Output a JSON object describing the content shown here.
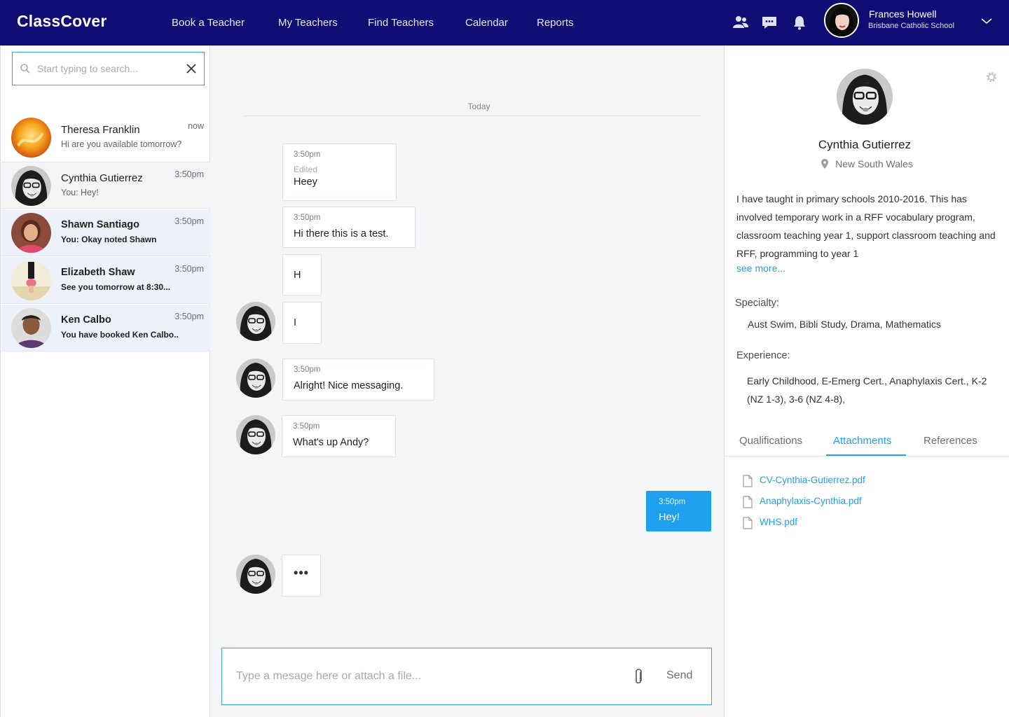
{
  "app": {
    "logo": "ClassCover"
  },
  "nav": [
    "Book a Teacher",
    "My Teachers",
    "Find Teachers",
    "Calendar",
    "Reports"
  ],
  "user": {
    "name": "Frances Howell",
    "school": "Brisbane Catholic School"
  },
  "search": {
    "placeholder": "Start typing to search..."
  },
  "conversations": [
    {
      "name": "Theresa Franklin",
      "preview": "Hi are you available tomorrow?",
      "time": "now"
    },
    {
      "name": "Cynthia Gutierrez",
      "preview": "You: Hey!",
      "time": "3:50pm"
    },
    {
      "name": "Shawn Santiago",
      "preview": "You: Okay noted Shawn",
      "time": "3:50pm"
    },
    {
      "name": "Elizabeth Shaw",
      "preview": "See you tomorrow at 8:30...",
      "time": "3:50pm"
    },
    {
      "name": "Ken Calbo",
      "preview": "You have booked Ken Calbo..",
      "time": "3:50pm"
    }
  ],
  "chat": {
    "day": "Today",
    "messages": [
      {
        "time": "3:50pm",
        "edited": "Edited",
        "text": "Heey"
      },
      {
        "time": "3:50pm",
        "text": "Hi there this is a test."
      },
      {
        "text": "H"
      },
      {
        "text": "I"
      },
      {
        "time": "3:50pm",
        "text": "Alright! Nice messaging."
      },
      {
        "time": "3:50pm",
        "text": "What's up Andy?"
      },
      {
        "time": "3:50pm",
        "text": "Hey!"
      },
      {
        "text": "•••"
      }
    ],
    "composer_placeholder": "Type a mesage here or attach a file...",
    "send": "Send"
  },
  "profile": {
    "name": "Cynthia Gutierrez",
    "location": "New South Wales",
    "bio": "I have taught in primary schools 2010-2016. This has involved temporary work in a RFF vocabulary program, classroom teaching year 1, support classroom teaching and RFF, programming to year 1",
    "see_more": "see more...",
    "specialty_label": "Specialty:",
    "specialty": "Aust Swim, Bibli Study, Drama, Mathematics",
    "experience_label": "Experience:",
    "experience": "Early Childhood, E-Emerg Cert., Anaphylaxis Cert., K-2 (NZ 1-3), 3-6 (NZ 4-8),",
    "tabs": [
      "Qualifications",
      "Attachments",
      "References"
    ],
    "active_tab": "Attachments",
    "attachments": [
      "CV-Cynthia-Gutierrez.pdf",
      "Anaphylaxis-Cynthia.pdf",
      "WHS.pdf"
    ]
  },
  "colors": {
    "nav_bg": "#0f0c74",
    "accent": "#1fa0ef",
    "unread_bg": "#edf2fa"
  }
}
